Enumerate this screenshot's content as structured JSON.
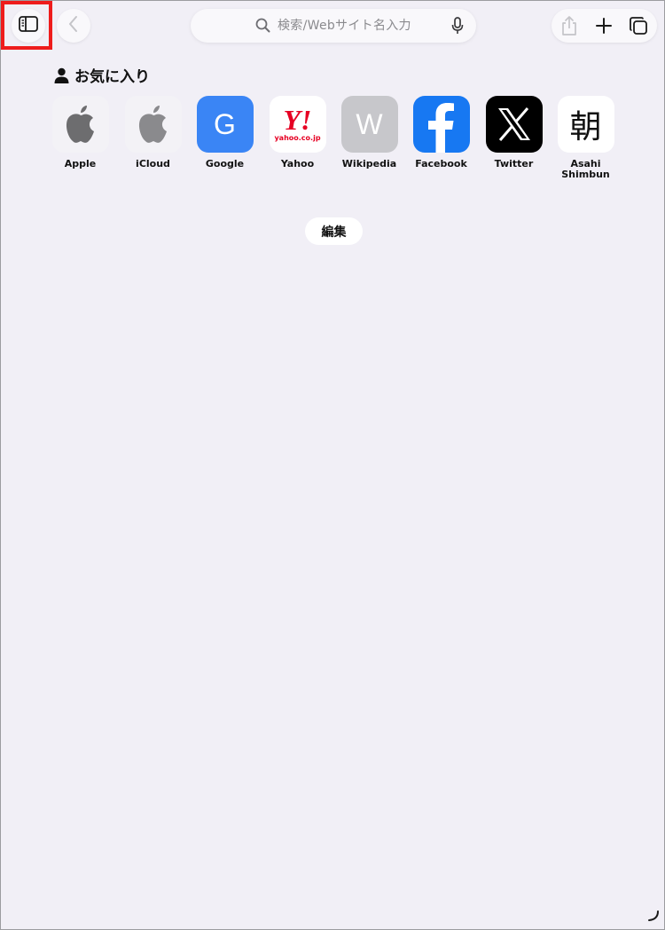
{
  "toolbar": {
    "sidebar_icon": "sidebar-icon",
    "back_icon": "chevron-left-icon",
    "search_placeholder": "検索/Webサイト名入力",
    "share_icon": "share-icon",
    "new_tab_icon": "plus-icon",
    "tabs_icon": "tabs-overview-icon"
  },
  "favorites": {
    "title": "お気に入り",
    "items": [
      {
        "label": "Apple",
        "icon": "apple-logo-icon"
      },
      {
        "label": "iCloud",
        "icon": "apple-logo-icon"
      },
      {
        "label": "Google",
        "icon": "letter-g-icon",
        "letter": "G"
      },
      {
        "label": "Yahoo",
        "icon": "yahoo-logo-icon",
        "logo_text": "Y!",
        "sub_text": "yahoo.co.jp"
      },
      {
        "label": "Wikipedia",
        "icon": "letter-w-icon",
        "letter": "W"
      },
      {
        "label": "Facebook",
        "icon": "facebook-logo-icon"
      },
      {
        "label": "Twitter",
        "icon": "x-logo-icon"
      },
      {
        "label": "Asahi\nShimbun",
        "icon": "asahi-logo-icon",
        "logo_text": "朝"
      }
    ]
  },
  "edit_label": "編集",
  "colors": {
    "highlight": "#ee1c1c",
    "google_blue": "#3a85f5",
    "facebook_blue": "#1778f2",
    "yahoo_red": "#e60023",
    "wikipedia_gray": "#c7c7cb"
  }
}
